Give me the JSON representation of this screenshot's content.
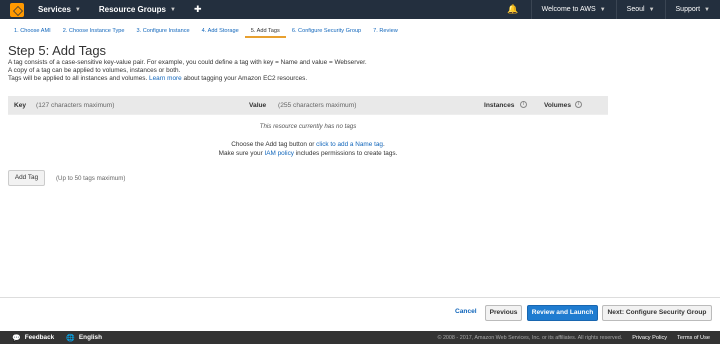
{
  "topnav": {
    "services": "Services",
    "resource_groups": "Resource Groups",
    "welcome": "Welcome to AWS",
    "region": "Seoul",
    "support": "Support"
  },
  "wizard": {
    "tabs": [
      {
        "label": "1. Choose AMI"
      },
      {
        "label": "2. Choose Instance Type"
      },
      {
        "label": "3. Configure Instance"
      },
      {
        "label": "4. Add Storage"
      },
      {
        "label": "5. Add Tags"
      },
      {
        "label": "6. Configure Security Group"
      },
      {
        "label": "7. Review"
      }
    ],
    "active_index": 4
  },
  "step": {
    "title": "Step 5: Add Tags",
    "line1": "A tag consists of a case-sensitive key-value pair. For example, you could define a tag with key = Name and value = Webserver.",
    "line2": "A copy of a tag can be applied to volumes, instances or both.",
    "line3": "Tags will be applied to all instances and volumes.",
    "learn_more": "Learn more",
    "line3_tail": "about tagging your Amazon EC2 resources."
  },
  "table": {
    "key_header": "Key",
    "key_hint": "(127 characters maximum)",
    "value_header": "Value",
    "value_hint": "(255 characters maximum)",
    "instances_header": "Instances",
    "volumes_header": "Volumes",
    "empty_message": "This resource currently has no tags",
    "choose_text": "Choose the Add tag button or",
    "choose_link": "click to add a Name tag",
    "choose_end": ".",
    "iam_pre": "Make sure your",
    "iam_link": "IAM policy",
    "iam_post": "includes permissions to create tags."
  },
  "add_tag": {
    "label": "Add Tag",
    "hint": "(Up to 50 tags maximum)"
  },
  "actions": {
    "cancel": "Cancel",
    "previous": "Previous",
    "review_launch": "Review and Launch",
    "next": "Next: Configure Security Group"
  },
  "footer": {
    "feedback": "Feedback",
    "language": "English",
    "copyright": "© 2008 - 2017, Amazon Web Services, Inc. or its affiliates. All rights reserved.",
    "privacy": "Privacy Policy",
    "terms": "Terms of Use"
  },
  "colors": {
    "nav_bg": "#232f3e",
    "link": "#1166bb",
    "primary_button": "#1f7cd0",
    "active_tab_underline": "#e8a02f"
  }
}
